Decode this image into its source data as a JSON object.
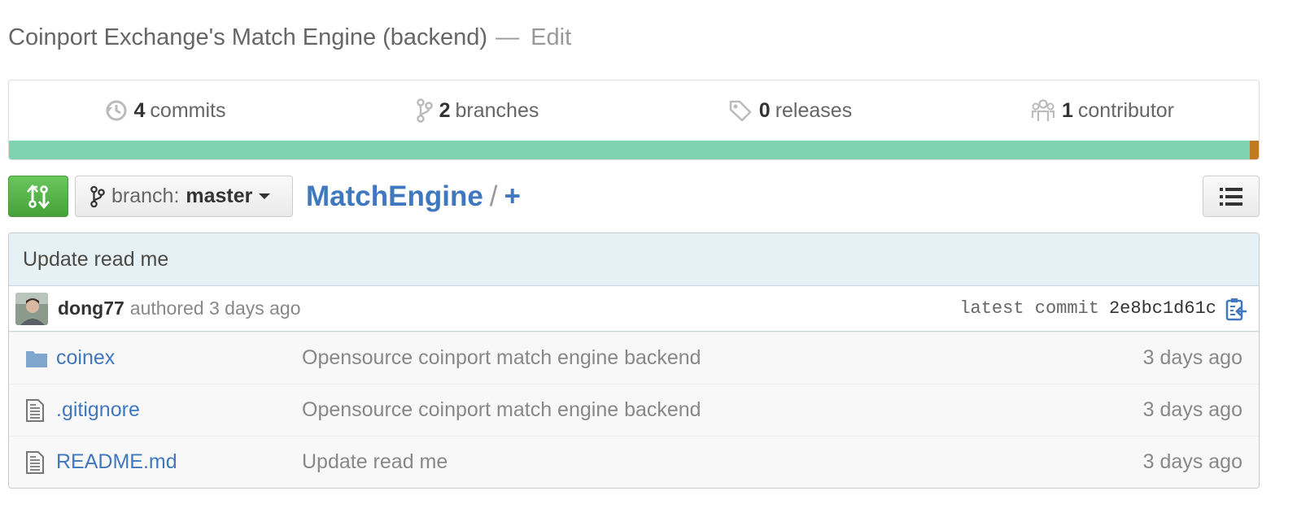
{
  "repo": {
    "description": "Coinport Exchange's Match Engine (backend)",
    "dash": "—",
    "edit_label": "Edit",
    "name": "MatchEngine",
    "path_sep": "/",
    "add_label": "+"
  },
  "stats": [
    {
      "icon": "history-icon",
      "count": "4",
      "label": "commits"
    },
    {
      "icon": "branch-icon",
      "count": "2",
      "label": "branches"
    },
    {
      "icon": "tag-icon",
      "count": "0",
      "label": "releases"
    },
    {
      "icon": "organization-icon",
      "count": "1",
      "label": "contributor"
    }
  ],
  "languages": [
    {
      "color": "#7fd3af",
      "percent": 99.3
    },
    {
      "color": "#c07a24",
      "percent": 0.7
    }
  ],
  "branch": {
    "prefix": "branch:",
    "name": "master"
  },
  "commit": {
    "title": "Update read me",
    "author": "dong77",
    "authored": "authored 3 days ago",
    "latest_label": "latest commit",
    "sha": "2e8bc1d61c"
  },
  "files": [
    {
      "type": "dir",
      "icon": "folder-icon",
      "name": "coinex",
      "message": "Opensource coinport match engine backend",
      "age": "3 days ago"
    },
    {
      "type": "file",
      "icon": "file-text-icon",
      "name": ".gitignore",
      "message": "Opensource coinport match engine backend",
      "age": "3 days ago"
    },
    {
      "type": "file",
      "icon": "file-text-icon",
      "name": "README.md",
      "message": "Update read me",
      "age": "3 days ago"
    }
  ],
  "colors": {
    "link": "#4078c0",
    "compare_green": "#55b448",
    "commit_bg": "#e6f1f6"
  }
}
